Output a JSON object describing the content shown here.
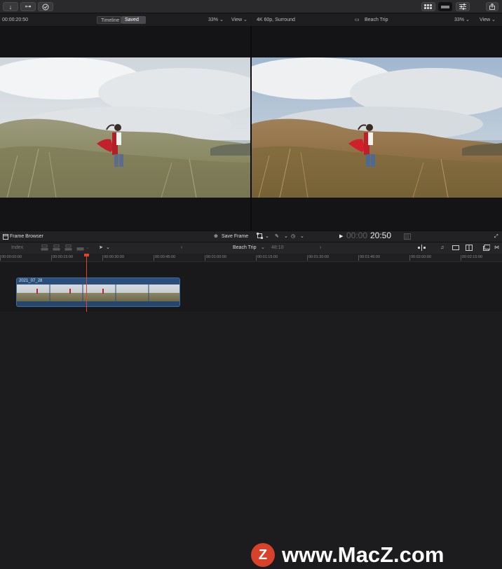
{
  "toolbar": {
    "import_icon": "↓",
    "keywords_icon": "⊶",
    "background_tasks_icon": "✓"
  },
  "viewer_left": {
    "timecode": "00:00:20:50",
    "seg_timeline": "Timeline",
    "seg_saved": "Saved",
    "zoom": "33%",
    "view": "View"
  },
  "viewer_right": {
    "format": "4K 60p, Surround",
    "project": "Beach Trip",
    "zoom": "33%",
    "view": "View"
  },
  "viewer_bar": {
    "frame_browser": "Frame Browser",
    "save_frame": "Save Frame",
    "timecode_dim": "00:00",
    "timecode": "20:50"
  },
  "timeline_bar": {
    "index": "Index",
    "project": "Beach Trip",
    "duration": "48:10"
  },
  "ruler": {
    "ticks": [
      "00:00:00:00",
      "00:00:15:00",
      "00:00:30:00",
      "00:00:45:00",
      "00:01:00:00",
      "00:01:15:00",
      "00:01:30:00",
      "00:01:45:00",
      "00:02:00:00",
      "00:02:15:00"
    ]
  },
  "clip": {
    "name": "2021_07_28"
  },
  "watermark": {
    "logo": "Z",
    "text": "www.MacZ.com"
  },
  "colors": {
    "accent_blue": "#2a4f7a",
    "playhead": "#e2432b",
    "watermark_red": "#d8412c"
  }
}
